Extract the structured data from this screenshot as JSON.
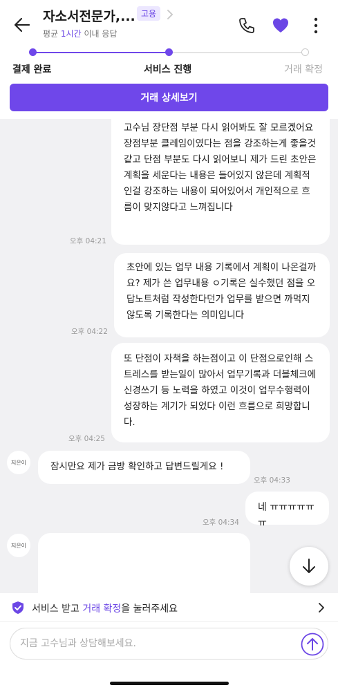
{
  "header": {
    "title": "자소서전문가,...",
    "badge": "고용",
    "subtitle_prefix": "평균 ",
    "subtitle_accent": "1시간",
    "subtitle_suffix": " 이내 응답",
    "heart_color": "#6b46e5"
  },
  "progress": {
    "steps": [
      {
        "label": "결제 완료",
        "state": "done"
      },
      {
        "label": "서비스 진행",
        "state": "current"
      },
      {
        "label": "거래 확정",
        "state": "pending"
      }
    ],
    "accent_color": "#6f47ea"
  },
  "detail_button": {
    "label": "거래 상세보기"
  },
  "messages": [
    {
      "side": "right",
      "text": "고수님 장단점 부분 다시 읽어봐도 잘 모르겠어요 장점부분 클레임이였다는 점을 강조하는게 좋을것같고 단점 부분도 다시 읽어보니 제가 드린 초안은 계획을 세운다는 내용은 들어있지 않은데 계획적인걸 강조하는 내용이 되어있어서 개인적으로 흐름이 맞지않다고 느껴집니다",
      "time": "오후 04:21"
    },
    {
      "side": "right",
      "text": "초안에 있는 업무 내용 기록에서 계획이 나온걸까요? 제가 쓴 업무내용 ㅇ기록은 실수했던 점을 오답노트처럼 작성한다던가 업무를 받으면 까먹지않도록 기록한다는 의미입니다",
      "time": "오후 04:22"
    },
    {
      "side": "right",
      "text": "또 단점이 자책을 하는점이고 이 단점으로인해 스트레스를 받는일이 많아서 업무기록과 더블체크에 신경쓰기 등 노력을 하였고 이것이 업무수행력이 성장하는 계기가 되었다 이런 흐름으로 희망합니다.",
      "time": "오후 04:25"
    },
    {
      "side": "left",
      "avatar": "지은이",
      "text": "잠시만요 제가 금방 확인하고 답변드릴게요 !",
      "time": "오후 04:33"
    },
    {
      "side": "right",
      "text": "네 ㅠㅠㅠㅠㅠㅠ",
      "time": "오후 04:34"
    },
    {
      "side": "left",
      "avatar": "지은이",
      "text": "",
      "time": ""
    }
  ],
  "notice": {
    "prefix": "서비스 받고 ",
    "accent": "거래 확정",
    "suffix": "을 눌러주세요"
  },
  "input": {
    "placeholder": "지금 고수님과 상담해보세요."
  }
}
